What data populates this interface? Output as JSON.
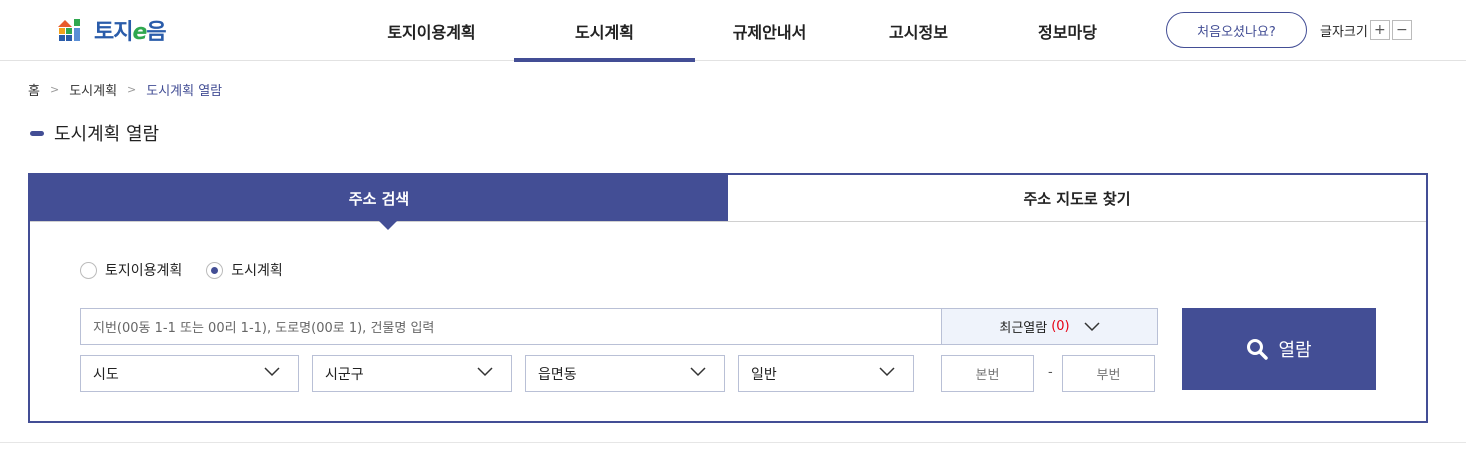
{
  "header": {
    "logo_text_a": "토지",
    "logo_text_e": "e",
    "logo_text_b": "음",
    "nav": [
      {
        "label": "토지이용계획",
        "active": false
      },
      {
        "label": "도시계획",
        "active": true
      },
      {
        "label": "규제안내서",
        "active": false
      },
      {
        "label": "고시정보",
        "active": false
      },
      {
        "label": "정보마당",
        "active": false
      }
    ],
    "help_button": "처음오셨나요?",
    "font_size_label": "글자크기",
    "font_plus": "+",
    "font_minus": "−"
  },
  "breadcrumb": [
    "홈",
    "도시계획",
    "도시계획 열람"
  ],
  "page_title": "도시계획 열람",
  "tabs": [
    {
      "label": "주소 검색",
      "active": true
    },
    {
      "label": "주소 지도로 찾기",
      "active": false
    }
  ],
  "radios": [
    {
      "label": "토지이용계획",
      "checked": false
    },
    {
      "label": "도시계획",
      "checked": true
    }
  ],
  "search": {
    "placeholder": "지번(00동 1-1 또는 00리 1-1), 도로명(00로 1), 건물명 입력",
    "recent_label": "최근열람",
    "recent_count": "(0)",
    "selects": [
      "시도",
      "시군구",
      "읍면동",
      "일반"
    ],
    "bonbun_placeholder": "본번",
    "dash": "-",
    "bubun_placeholder": "부번",
    "submit_label": "열람"
  },
  "colors": {
    "accent": "#434e95",
    "count_red": "#e60012",
    "recent_bg": "#eff3fb"
  }
}
